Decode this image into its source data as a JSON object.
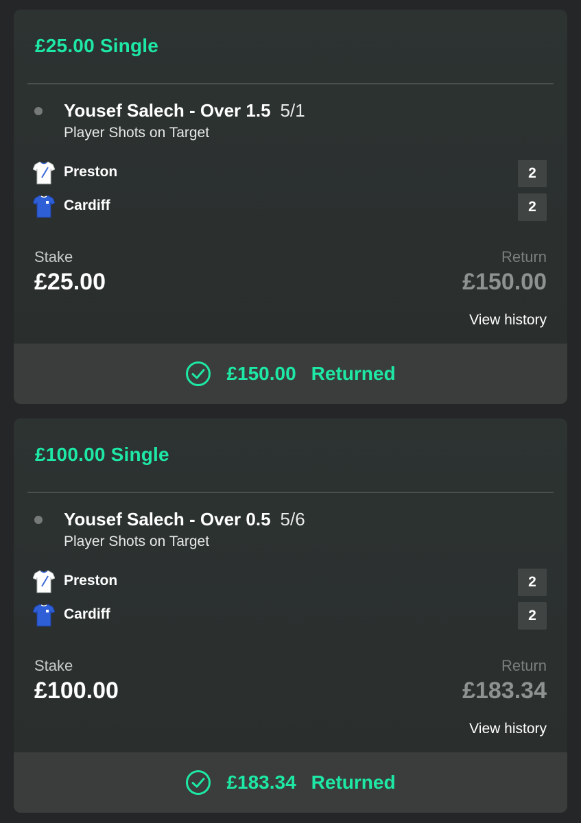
{
  "bets": [
    {
      "title": "£25.00 Single",
      "selection": "Yousef Salech - Over 1.5",
      "odds": "5/1",
      "market": "Player Shots on Target",
      "teams": [
        {
          "name": "Preston",
          "score": "2",
          "shirt_color": "#ffffff",
          "shirt_accent": "#3a6ad8"
        },
        {
          "name": "Cardiff",
          "score": "2",
          "shirt_color": "#2f5fd6",
          "shirt_accent": "#ffffff"
        }
      ],
      "stake_label": "Stake",
      "stake": "£25.00",
      "return_label": "Return",
      "return": "£150.00",
      "history_link": "View history",
      "returned_amount": "£150.00",
      "returned_label": "Returned"
    },
    {
      "title": "£100.00 Single",
      "selection": "Yousef Salech - Over 0.5",
      "odds": "5/6",
      "market": "Player Shots on Target",
      "teams": [
        {
          "name": "Preston",
          "score": "2",
          "shirt_color": "#ffffff",
          "shirt_accent": "#3a6ad8"
        },
        {
          "name": "Cardiff",
          "score": "2",
          "shirt_color": "#2f5fd6",
          "shirt_accent": "#ffffff"
        }
      ],
      "stake_label": "Stake",
      "stake": "£100.00",
      "return_label": "Return",
      "return": "£183.34",
      "history_link": "View history",
      "returned_amount": "£183.34",
      "returned_label": "Returned"
    }
  ],
  "colors": {
    "accent": "#1ee8a5",
    "card_bg": "#2c3130",
    "footer_bg": "#3a3d3b",
    "score_bg": "#404442"
  },
  "icons": {
    "settled": "check-circle-icon",
    "team_kit": "shirt-icon",
    "selection_status": "status-dot-icon"
  }
}
